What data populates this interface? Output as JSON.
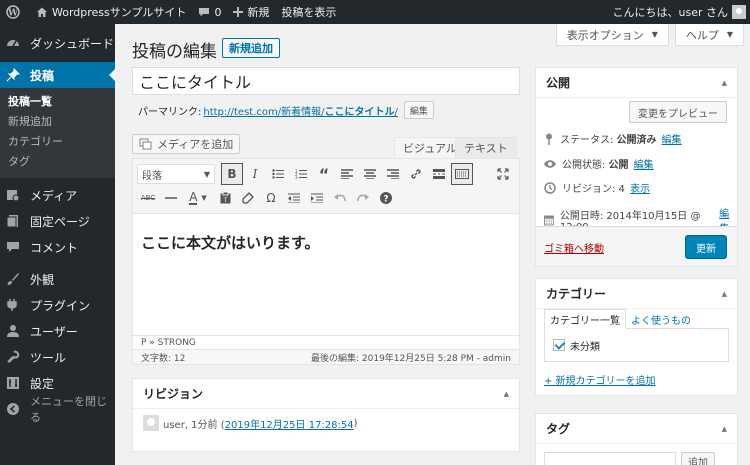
{
  "adminbar": {
    "site_name": "Wordpressサンプルサイト",
    "comments_count": "0",
    "new_label": "新規",
    "view_post_label": "投稿を表示",
    "greeting": "こんにちは、user さん"
  },
  "sidebar": {
    "items": [
      {
        "label": "ダッシュボード",
        "icon": "dashboard-icon"
      },
      {
        "label": "投稿",
        "icon": "pin-icon"
      },
      {
        "label": "メディア",
        "icon": "media-icon"
      },
      {
        "label": "固定ページ",
        "icon": "page-icon"
      },
      {
        "label": "コメント",
        "icon": "comment-icon"
      },
      {
        "label": "外観",
        "icon": "brush-icon"
      },
      {
        "label": "プラグイン",
        "icon": "plugin-icon"
      },
      {
        "label": "ユーザー",
        "icon": "user-icon"
      },
      {
        "label": "ツール",
        "icon": "wrench-icon"
      },
      {
        "label": "設定",
        "icon": "settings-icon"
      }
    ],
    "submenu": [
      "投稿一覧",
      "新規追加",
      "カテゴリー",
      "タグ"
    ],
    "collapse_label": "メニューを閉じる"
  },
  "screen_options": "表示オプション",
  "help": "ヘルプ",
  "page": {
    "title": "投稿の編集",
    "add_new": "新規追加"
  },
  "post": {
    "title": "ここにタイトル",
    "permalink_label": "パーマリンク:",
    "permalink_base": "http://test.com/新着情報/",
    "permalink_slug": "ここにタイトル",
    "permalink_end": "/",
    "edit_slug": "編集",
    "body": "ここに本文がはいります。"
  },
  "editor": {
    "add_media": "メディアを追加",
    "tab_visual": "ビジュアル",
    "tab_text": "テキスト",
    "format_select": "段落",
    "path": "P » STRONG",
    "word_count": "文字数: 12",
    "last_edited": "最後の編集: 2019年12月25日 5:28 PM - admin"
  },
  "revisions": {
    "title": "リビジョン",
    "entry_prefix": "user, 1分前 (",
    "entry_link": "2019年12月25日 17:28:54",
    "entry_suffix": ")"
  },
  "publish": {
    "title": "公開",
    "preview": "変更をプレビュー",
    "status_label": "ステータス:",
    "status_value": "公開済み",
    "visibility_label": "公開状態:",
    "visibility_value": "公開",
    "revisions_label": "リビジョン: 4",
    "revisions_link": "表示",
    "date_label": "公開日時: 2014年10月15日 @ 12:00",
    "edit": "編集",
    "trash": "ゴミ箱へ移動",
    "update": "更新"
  },
  "categories": {
    "title": "カテゴリー",
    "tab_all": "カテゴリー一覧",
    "tab_popular": "よく使うもの",
    "items": [
      {
        "label": "未分類",
        "checked": true
      }
    ],
    "add_new": "+ 新規カテゴリーを追加"
  },
  "tags": {
    "title": "タグ",
    "add": "追加"
  },
  "colors": {
    "admin_dark": "#23282d",
    "accent": "#0073aa",
    "update_button": "#0085ba",
    "trash": "#a00"
  }
}
